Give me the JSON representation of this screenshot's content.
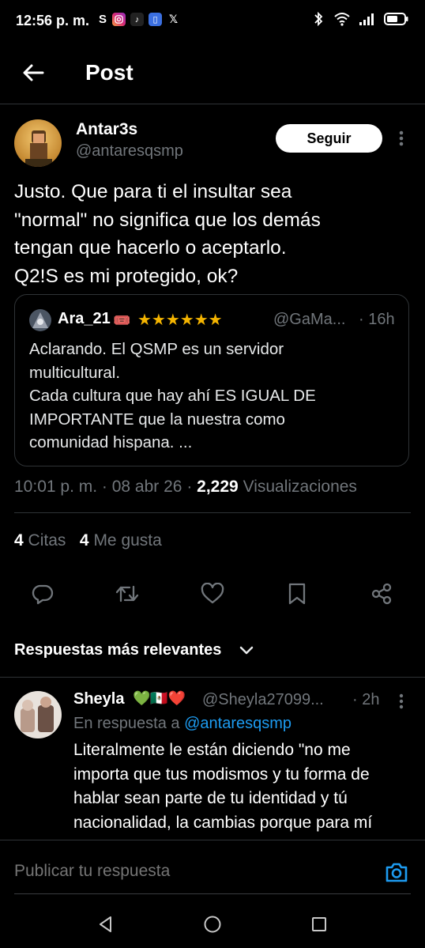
{
  "status_bar": {
    "time": "12:56 p. m.",
    "s_label": "S"
  },
  "header": {
    "title": "Post"
  },
  "post": {
    "author_name": "Antar3s",
    "author_handle": "@antaresqsmp",
    "follow_label": "Seguir",
    "text": "Justo. Que para ti el insultar sea\n\"normal\" no significa que los demás\ntengan que hacerlo o aceptarlo.\nQ2!S es mi protegido, ok?",
    "quote": {
      "name": "Ara_21",
      "badge": "🎟️",
      "stars": "★★★★★★",
      "handle": "@GaMa...",
      "time": "· 16h",
      "text": "Aclarando. El QSMP es un servidor\nmulticultural.\nCada cultura que hay ahí ES IGUAL DE\nIMPORTANTE que la nuestra como\ncomunidad hispana. ..."
    },
    "meta": {
      "time": "10:01 p. m.",
      "date": "08 abr 26",
      "views_count": "2,229",
      "views_label": "Visualizaciones"
    },
    "counts": {
      "quotes_count": "4",
      "quotes_label": "Citas",
      "likes_count": "4",
      "likes_label": "Me gusta"
    }
  },
  "replies": {
    "heading": "Respuestas más relevantes",
    "items": [
      {
        "name": "Sheyla",
        "emoji": "💚🇲🇽❤️",
        "handle": "@Sheyla27099...",
        "time": "· 2h",
        "reply_to_prefix": "En respuesta a",
        "reply_to_handle": "@antaresqsmp",
        "text": "Literalmente le están diciendo \"no me\nimporta que tus modismos y tu forma de\nhablar sean parte de tu identidad y tú\nnacionalidad, la cambias porque para mí"
      }
    ]
  },
  "composer": {
    "placeholder": "Publicar tu respuesta"
  },
  "colors": {
    "accent": "#1d9bf0",
    "background": "#000000",
    "secondary_text": "#71767b",
    "star": "#f4b400"
  }
}
